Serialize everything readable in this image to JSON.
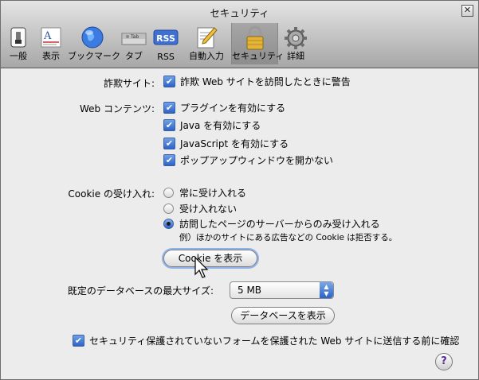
{
  "window": {
    "title": "セキュリティ",
    "close_glyph": "✕"
  },
  "toolbar": {
    "items": [
      {
        "label": "一般",
        "icon": "switch-icon"
      },
      {
        "label": "表示",
        "icon": "font-icon"
      },
      {
        "label": "ブックマーク",
        "icon": "globe-icon"
      },
      {
        "label": "タブ",
        "icon": "tab-icon"
      },
      {
        "label": "RSS",
        "icon": "rss-icon"
      },
      {
        "label": "自動入力",
        "icon": "pencil-form-icon"
      },
      {
        "label": "セキュリティ",
        "icon": "lock-icon",
        "selected": true
      },
      {
        "label": "詳細",
        "icon": "gear-icon"
      }
    ],
    "tab_icon_text": "Tab",
    "rss_icon_text": "RSS"
  },
  "fraud": {
    "label": "詐欺サイト:",
    "checkbox_label": "詐欺 Web サイトを訪問したときに警告",
    "checked": true
  },
  "web_content": {
    "label": "Web コンテンツ:",
    "options": [
      {
        "label": "プラグインを有効にする",
        "checked": true
      },
      {
        "label": "Java を有効にする",
        "checked": true
      },
      {
        "label": "JavaScript を有効にする",
        "checked": true
      },
      {
        "label": "ポップアップウィンドウを開かない",
        "checked": true
      }
    ]
  },
  "cookies": {
    "label": "Cookie の受け入れ:",
    "options": [
      {
        "label": "常に受け入れる",
        "selected": false
      },
      {
        "label": "受け入れない",
        "selected": false
      },
      {
        "label": "訪問したページのサーバーからのみ受け入れる",
        "selected": true
      }
    ],
    "note": "例）ほかのサイトにある広告などの Cookie は拒否する。",
    "show_button": "Cookie を表示"
  },
  "database": {
    "label": "既定のデータベースの最大サイズ:",
    "selected_value": "5 MB",
    "show_button": "データベースを表示"
  },
  "secure_form": {
    "checkbox_label": "セキュリティ保護されていないフォームを保護された Web サイトに送信する前に確認",
    "checked": true
  },
  "help": {
    "glyph": "?"
  },
  "check_glyph": "✔",
  "colors": {
    "accent": "#2f63c6",
    "toolbar_top": "#e4e4e4",
    "toolbar_bottom": "#a7a7a7",
    "background": "#ececec"
  }
}
